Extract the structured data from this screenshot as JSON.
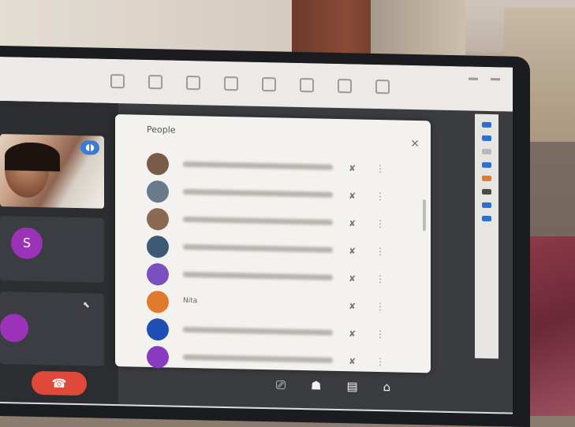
{
  "people_panel": {
    "title": "People",
    "close_icon": "close-icon",
    "participants": [
      {
        "name": "",
        "avatar_initial": "",
        "avatar_color": "#7a5a48",
        "mic_icon": "mic-off-icon",
        "more_icon": "more-vertical-icon"
      },
      {
        "name": "",
        "avatar_initial": "",
        "avatar_color": "#6b7a8a",
        "mic_icon": "mic-off-icon",
        "more_icon": "more-vertical-icon"
      },
      {
        "name": "",
        "avatar_initial": "",
        "avatar_color": "#8a6a52",
        "mic_icon": "mic-off-icon",
        "more_icon": "more-vertical-icon"
      },
      {
        "name": "",
        "avatar_initial": "",
        "avatar_color": "#3d5a75",
        "mic_icon": "mic-off-icon",
        "more_icon": "more-vertical-icon"
      },
      {
        "name": "",
        "avatar_initial": "",
        "avatar_color": "#7b4fc0",
        "mic_icon": "mic-off-icon",
        "more_icon": "more-vertical-icon"
      },
      {
        "name": "Nita",
        "avatar_initial": "",
        "avatar_color": "#e07a2c",
        "mic_icon": "mic-off-icon",
        "more_icon": "more-vertical-icon"
      },
      {
        "name": "",
        "avatar_initial": "",
        "avatar_color": "#1f4fb5",
        "mic_icon": "mic-off-icon",
        "more_icon": "more-vertical-icon"
      },
      {
        "name": "",
        "avatar_initial": "",
        "avatar_color": "#8a3ac0",
        "mic_icon": "mic-off-icon",
        "more_icon": "more-vertical-icon"
      }
    ]
  },
  "stage": {
    "tile_avatar_initial": "S",
    "tile_name": "",
    "leave_icon": "phone-hangup-icon"
  },
  "controls": [
    "screen-share-icon",
    "people-icon",
    "chat-icon",
    "more-icon"
  ],
  "colors": {
    "panel_bg": "#f4f2ef",
    "leave_button": "#e0483a",
    "avatar_purple": "#9a33b8",
    "toolbar_bg": "#ece9e6"
  }
}
